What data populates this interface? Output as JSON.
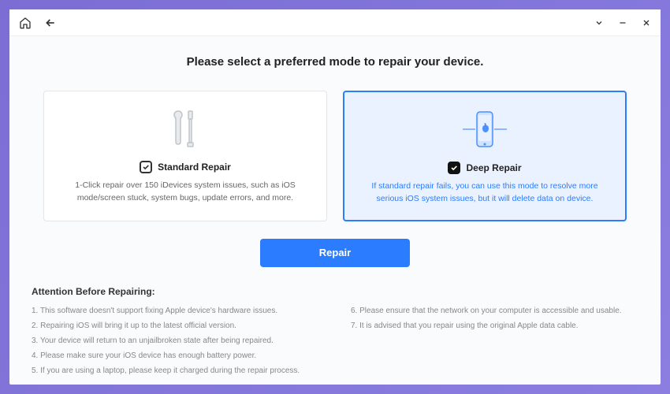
{
  "page_title": "Please select a preferred mode to repair your device.",
  "cards": {
    "standard": {
      "label": "Standard Repair",
      "description": "1-Click repair over 150 iDevices system issues, such as iOS mode/screen stuck, system bugs, update errors, and more.",
      "selected": false
    },
    "deep": {
      "label": "Deep Repair",
      "description": "If standard repair fails, you can use this mode to resolve more serious iOS system issues, but it will delete data on device.",
      "selected": true
    }
  },
  "repair_button": "Repair",
  "attention": {
    "title": "Attention Before Repairing:",
    "items": [
      "1. This software doesn't support fixing Apple device's hardware issues.",
      "2. Repairing iOS will bring it up to the latest official version.",
      "3. Your device will return to an unjailbroken state after being repaired.",
      "4. Please make sure your iOS device has enough battery power.",
      "5. If you are using a laptop, please keep it charged during the repair process.",
      "6. Please ensure that the network on your computer is accessible and usable.",
      "7. It is advised that you repair using the original Apple data cable."
    ]
  }
}
